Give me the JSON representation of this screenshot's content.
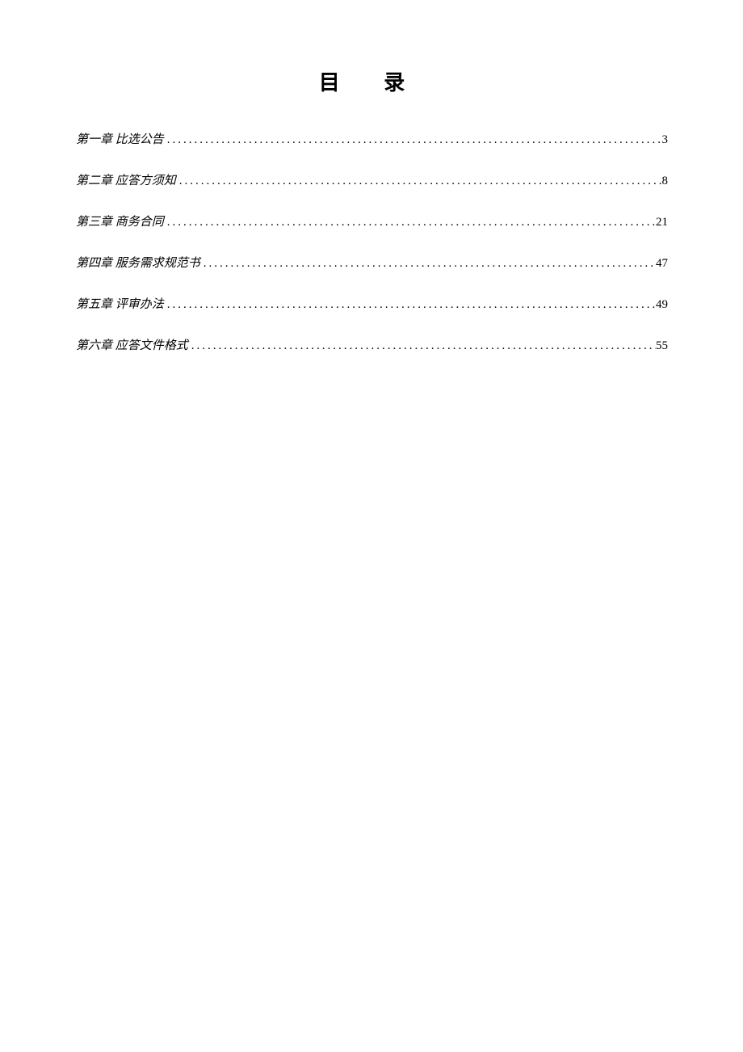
{
  "title": "目 录",
  "toc": {
    "entries": [
      {
        "label": "第一章 比选公告",
        "page": "3"
      },
      {
        "label": "第二章 应答方须知",
        "page": "8"
      },
      {
        "label": "第三章 商务合同",
        "page": "21"
      },
      {
        "label": "第四章 服务需求规范书",
        "page": "47"
      },
      {
        "label": "第五章 评审办法",
        "page": "49"
      },
      {
        "label": "第六章 应答文件格式",
        "page": "55"
      }
    ]
  }
}
